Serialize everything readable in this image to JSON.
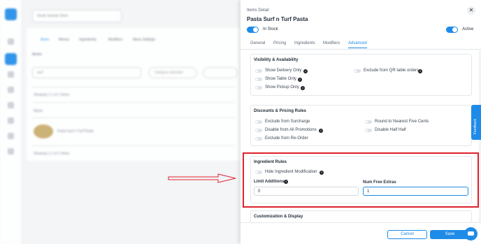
{
  "background": {
    "store_select": "Studs Sample Store",
    "nav_tabs": [
      "Items",
      "Menus",
      "Ingredients",
      "Modifiers",
      "Menu Settings"
    ],
    "items_label": "Items:",
    "search_value": "surf",
    "filter_placeholder": "Category selected",
    "showing_top": "Showing 1-1 of 1 Items",
    "column_name": "Name",
    "item_name": "Pasta Surf n Turf Pasta",
    "showing_bottom": "Showing 1-1 of 1 Items"
  },
  "panel": {
    "subtitle": "Items Detail",
    "title": "Pasta Surf n Turf Pasta",
    "close_glyph": "✕",
    "in_stock_label": "In Stock",
    "active_label": "Active",
    "tabs": [
      "General",
      "Pricing",
      "Ingredients",
      "Modifiers",
      "Advanced"
    ],
    "visibility": {
      "title": "Visibility & Availability",
      "options": [
        "Show Delivery Only",
        "Show Table Only",
        "Show Pickup Only",
        "Exclude from QR table orders"
      ]
    },
    "discounts": {
      "title": "Discounts & Pricing Rules",
      "options": [
        "Exclude from Surcharge",
        "Disable from All Promotions",
        "Exclude from Re-Order",
        "Round to Nearest Five Cents",
        "Disable Half Half"
      ]
    },
    "ingredient_rules": {
      "title": "Ingredient Rules",
      "hide_label": "Hide Ingredient Modification",
      "limit_label": "Limit Additions",
      "limit_value": "0",
      "free_label": "Num Free Extras",
      "free_value": "1"
    },
    "customization": {
      "title": "Customization & Display"
    },
    "footer": {
      "cancel": "Cancel",
      "save": "Save"
    }
  },
  "feedback_label": "Feedback",
  "info_glyph": "i",
  "colors": {
    "accent": "#1f8be8",
    "highlight": "#e0212b"
  }
}
